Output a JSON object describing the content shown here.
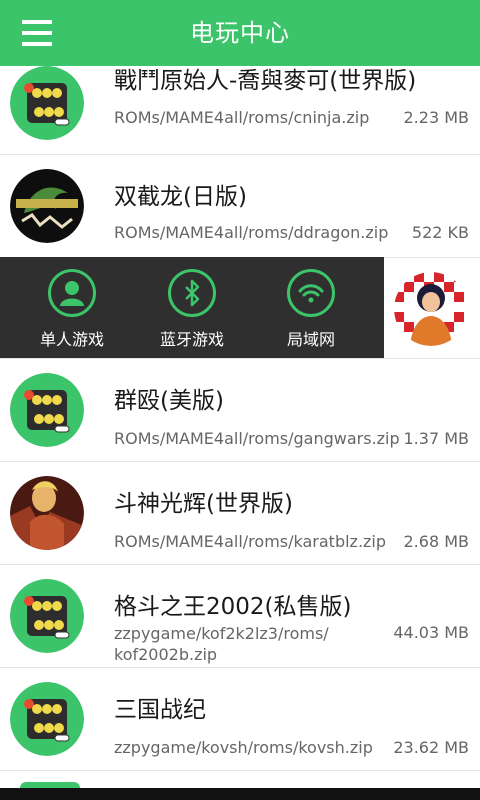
{
  "header": {
    "title": "电玩中心",
    "menu_icon": "hamburger-menu-icon"
  },
  "rows": [
    {
      "title": "戰鬥原始人-喬與麥可(世界版)",
      "path": "ROMs/MAME4all/roms/cninja.zip",
      "size": "2.23 MB",
      "icon": "arc-hub-logo"
    },
    {
      "title": "双截龙(日版)",
      "path": "ROMs/MAME4all/roms/ddragon.zip",
      "size": "522 KB",
      "icon": "double-dragon-art"
    },
    {
      "title": "",
      "path": "",
      "size": "",
      "icon": "checkered-girl-art"
    },
    {
      "title": "群殴(美版)",
      "path": "ROMs/MAME4all/roms/gangwars.zip",
      "size": "1.37 MB",
      "icon": "arc-hub-logo"
    },
    {
      "title": "斗神光辉(世界版)",
      "path": "ROMs/MAME4all/roms/karatblz.zip",
      "size": "2.68 MB",
      "icon": "karate-fighter-art"
    },
    {
      "title": "格斗之王2002(私售版)",
      "path": "zzpygame/kof2k2lz3/roms/ kof2002b.zip",
      "size": "44.03 MB",
      "icon": "arc-hub-logo"
    },
    {
      "title": "三国战纪",
      "path": "zzpygame/kovsh/roms/kovsh.zip",
      "size": "23.62 MB",
      "icon": "arc-hub-logo"
    }
  ],
  "overlay": {
    "items": [
      {
        "label": "单人游戏",
        "icon": "person-icon"
      },
      {
        "label": "蓝牙游戏",
        "icon": "bluetooth-icon"
      },
      {
        "label": "局域网",
        "icon": "wifi-icon"
      }
    ]
  },
  "colors": {
    "accent": "#3cc46a",
    "overlay_bg": "#2f2f2f",
    "text": "#1a1a1a",
    "muted": "#666666"
  }
}
